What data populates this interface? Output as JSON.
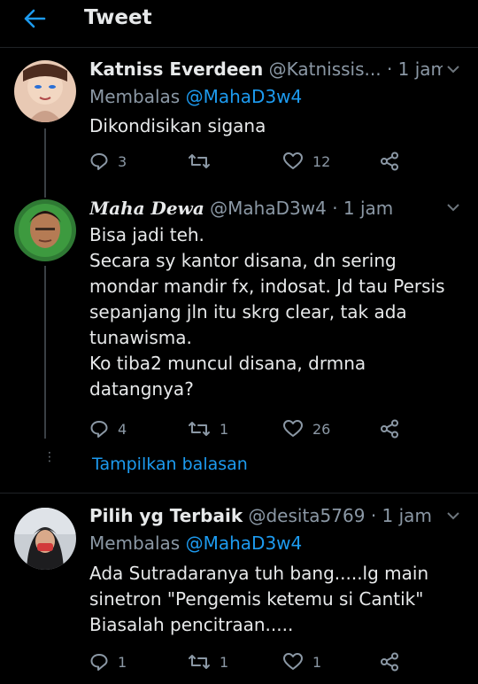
{
  "header": {
    "title": "Tweet",
    "back_icon": "arrow-left-icon"
  },
  "tweets": [
    {
      "name": "Katniss Everdeen",
      "handle": "@Katnissis...",
      "dot": "·",
      "time": "1 jam",
      "replying_prefix": "Membalas",
      "replying_to": "@MahaD3w4",
      "lines": [
        "Dikondisikan sigana"
      ],
      "replies": "3",
      "retweets": "",
      "likes": "12"
    },
    {
      "name": "Maha Dewa",
      "handle": "@MahaD3w4",
      "dot": "·",
      "time": "1 jam",
      "lines": [
        "Bisa jadi teh.",
        "Secara sy kantor disana, dn sering",
        "mondar mandir fx, indosat. Jd tau Persis",
        "sepanjang jln itu skrg clear, tak ada",
        "tunawisma.",
        "Ko tiba2 muncul disana, drmna",
        "datangnya?"
      ],
      "replies": "4",
      "retweets": "1",
      "likes": "26",
      "show_replies": "Tampilkan balasan"
    },
    {
      "name": "Pilih yg Terbaik",
      "handle": "@desita5769",
      "dot": "·",
      "time": "1 jam",
      "replying_prefix": "Membalas",
      "replying_to": "@MahaD3w4",
      "lines": [
        "Ada Sutradaranya tuh bang.....lg main",
        "sinetron \"Pengemis ketemu si Cantik\"",
        "Biasalah pencitraan....."
      ],
      "replies": "1",
      "retweets": "1",
      "likes": "1"
    }
  ],
  "colors": {
    "background": "#000000",
    "text": "#e7e9ea",
    "muted": "#8b98a5",
    "accent": "#1d9bf0"
  }
}
